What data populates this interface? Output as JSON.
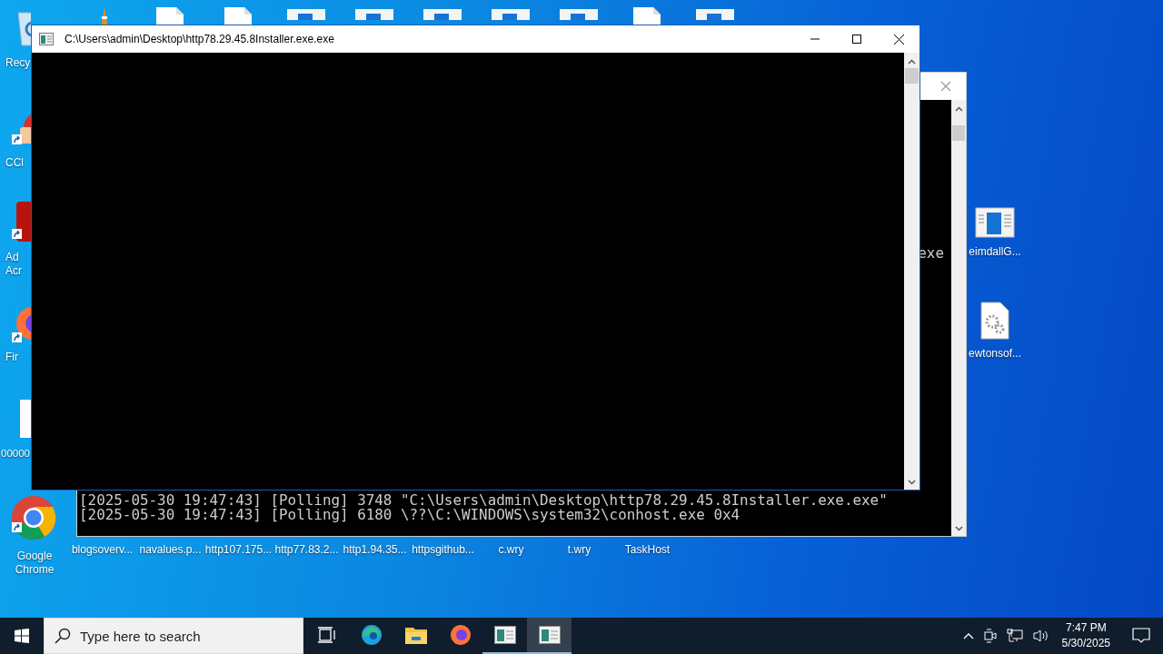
{
  "desktop": {
    "top_icons": [
      {
        "kind": "cone"
      },
      {
        "kind": "document"
      },
      {
        "kind": "document"
      },
      {
        "kind": "app-window"
      },
      {
        "kind": "app-window"
      },
      {
        "kind": "app-window"
      },
      {
        "kind": "app-window"
      },
      {
        "kind": "app-window"
      },
      {
        "kind": "document"
      },
      {
        "kind": "app-window"
      }
    ],
    "left_icons": [
      {
        "kind": "recycle-bin",
        "shortcut": false,
        "lines": [
          "Recy"
        ]
      },
      {
        "kind": "cleaner",
        "shortcut": true,
        "lines": [
          "CCl"
        ]
      },
      {
        "kind": "acrobat",
        "shortcut": true,
        "lines": [
          "Ad",
          "Acr"
        ]
      },
      {
        "kind": "firefox",
        "shortcut": true,
        "lines": [
          "Fir"
        ]
      },
      {
        "kind": "blank-file",
        "shortcut": false,
        "lines": [
          "00000"
        ]
      },
      {
        "kind": "chrome",
        "shortcut": true,
        "lines": [
          "Google",
          "Chrome"
        ]
      }
    ],
    "bottom_icons": [
      {
        "label": "blogsoverv..."
      },
      {
        "label": "navalues.p..."
      },
      {
        "label": "http107.175..."
      },
      {
        "label": "http77.83.2..."
      },
      {
        "label": "http1.94.35..."
      },
      {
        "label": "httpsgithub..."
      },
      {
        "label": "c.wry"
      },
      {
        "label": "t.wry"
      },
      {
        "label": "TaskHost"
      }
    ],
    "right_icons": [
      {
        "kind": "app-window",
        "label": "eimdallG..."
      },
      {
        "kind": "gear-document",
        "label": "ewtonsof..."
      }
    ]
  },
  "back_console": {
    "fragment": "exe",
    "lines": [
      "[2025-05-30 19:47:43] [Polling] 3748 \"C:\\Users\\admin\\Desktop\\http78.29.45.8Installer.exe.exe\"",
      "[2025-05-30 19:47:43] [Polling] 6180 \\??\\C:\\WINDOWS\\system32\\conhost.exe 0x4"
    ]
  },
  "front_console": {
    "title": "C:\\Users\\admin\\Desktop\\http78.29.45.8Installer.exe.exe"
  },
  "taskbar": {
    "search_placeholder": "Type here to search",
    "apps": [
      {
        "kind": "task-view",
        "open": false,
        "selected": false
      },
      {
        "kind": "edge",
        "open": false,
        "selected": false
      },
      {
        "kind": "explorer",
        "open": false,
        "selected": false
      },
      {
        "kind": "firefox",
        "open": false,
        "selected": false
      },
      {
        "kind": "console",
        "open": true,
        "selected": false
      },
      {
        "kind": "console",
        "open": true,
        "selected": true
      }
    ],
    "tray": [
      {
        "kind": "chevron"
      },
      {
        "kind": "camera"
      },
      {
        "kind": "network"
      },
      {
        "kind": "volume"
      }
    ],
    "time": "7:47 PM",
    "date": "5/30/2025"
  }
}
